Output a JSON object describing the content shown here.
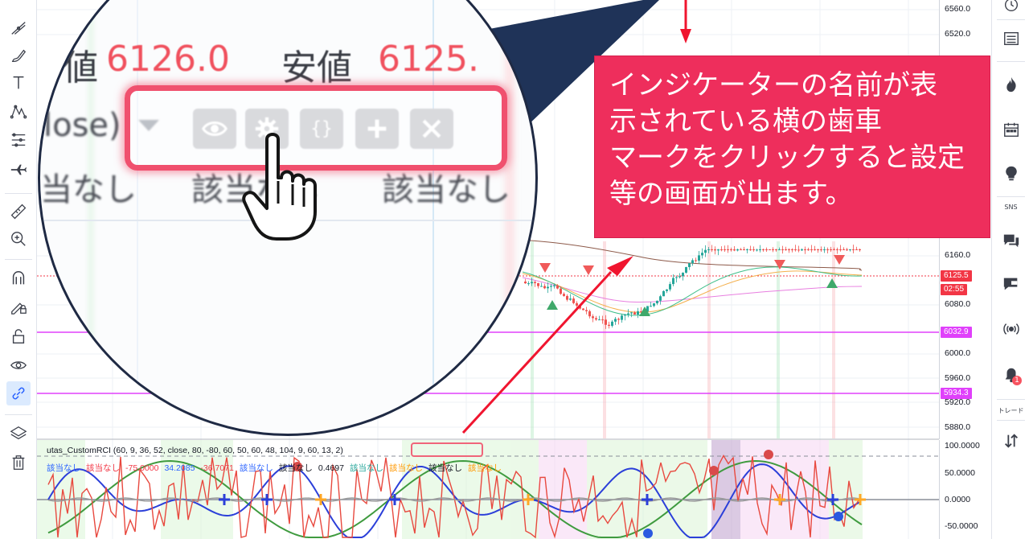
{
  "left_toolbar": {
    "tools": [
      {
        "name": "trend-line-tool-icon"
      },
      {
        "name": "brush-tool-icon"
      },
      {
        "name": "text-tool-icon"
      },
      {
        "name": "pattern-tool-icon"
      },
      {
        "name": "fib-tool-icon"
      },
      {
        "name": "forecast-tool-icon"
      },
      {
        "name": "ruler-icon"
      },
      {
        "name": "zoom-in-icon"
      },
      {
        "name": "magnet-icon"
      },
      {
        "name": "lock-drawing-pencil-icon"
      },
      {
        "name": "unlock-icon"
      },
      {
        "name": "eye-icon"
      },
      {
        "name": "link-icon"
      },
      {
        "name": "layers-icon"
      },
      {
        "name": "trash-icon"
      }
    ]
  },
  "right_panel": {
    "sns_label": "SNS",
    "trade_label": "トレード",
    "alert_count": "1"
  },
  "main_price_scale": {
    "ticks": [
      "6560.0",
      "6520.0",
      "6160.0",
      "6080.0",
      "6000.0",
      "5960.0",
      "5920.0",
      "5880.0"
    ],
    "last_price": "6125.5",
    "countdown": "02:55",
    "line_upper": "6032.9",
    "line_lower": "5934.3",
    "colors": {
      "last_price": "#f23645",
      "hline": "#e040fb"
    }
  },
  "indicator_scale": {
    "ticks": [
      "100.0000",
      "50.0000",
      "0.0000",
      "-50.0000"
    ]
  },
  "indicator": {
    "legend": "utas_CustomRCI (60, 9, 36, 52, close, 80, -80, 60, 50, 60, 48, 104, 9, 60, 13, 2)",
    "values": [
      {
        "text": "該当なし",
        "color": "#2962ff"
      },
      {
        "text": "該当なし",
        "color": "#f23645"
      },
      {
        "text": "-75.0000",
        "color": "#f23645"
      },
      {
        "text": "34.2085",
        "color": "#2962ff"
      },
      {
        "text": "-36.7071",
        "color": "#f23645"
      },
      {
        "text": "該当なし",
        "color": "#2962ff"
      },
      {
        "text": "該当なし",
        "color": "#131722"
      },
      {
        "text": "0.4697",
        "color": "#131722"
      },
      {
        "text": "該当なし",
        "color": "#26a69a"
      },
      {
        "text": "該当なし",
        "color": "#ff9800"
      },
      {
        "text": "該当なし",
        "color": "#131722"
      },
      {
        "text": "該当なし",
        "color": "#ff9800"
      }
    ]
  },
  "magnifier": {
    "high_label": "値",
    "high_value": "6126.0",
    "low_label": "安値",
    "low_value": "6125.",
    "source_label": "lose)",
    "na_1": "当なし",
    "na_2": "該当なし",
    "na_3": "該当なし"
  },
  "callout": {
    "text": "インジケーターの名前が表\n示されている横の歯車\nマークをクリックすると設定\n等の画面が出ます。",
    "color": "#ee2e5c"
  }
}
